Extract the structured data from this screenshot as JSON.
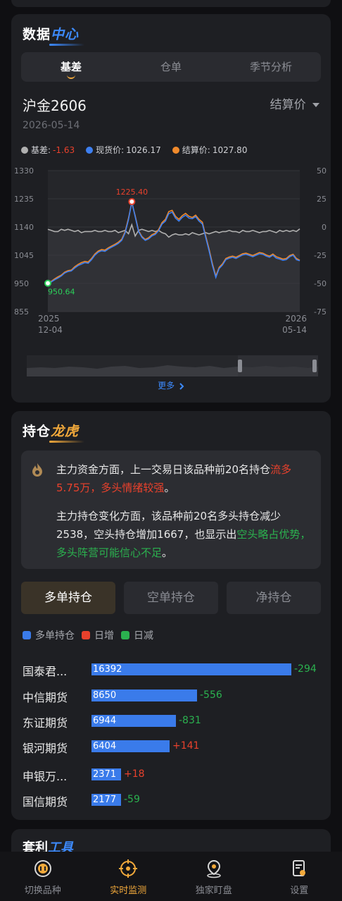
{
  "data_center": {
    "title_a": "数据",
    "title_b": "中心",
    "tabs": [
      "基差",
      "仓单",
      "季节分析"
    ],
    "active_tab": 0,
    "contract": "沪金2606",
    "price_type": "结算价",
    "date": "2026-05-14",
    "legend": {
      "basis_label": "基差:",
      "basis_value": "-1.63",
      "spot_label": "现货价:",
      "spot_value": "1026.17",
      "settle_label": "结算价:",
      "settle_value": "1027.80"
    },
    "more_label": "更多"
  },
  "chart_data": {
    "type": "line",
    "left_axis_ticks": [
      "1330",
      "1235",
      "1140",
      "1045",
      "950",
      "855"
    ],
    "right_axis_ticks": [
      "50",
      "25",
      "0",
      "-25",
      "-50",
      "-75"
    ],
    "ylim_left": [
      855,
      1330
    ],
    "ylim_right": [
      -75,
      50
    ],
    "x_start_label": [
      "2025",
      "12-04"
    ],
    "x_end_label": [
      "2026",
      "05-14"
    ],
    "max_label": "1225.40",
    "min_label": "950.64",
    "colors": {
      "basis": "#b0b0b0",
      "spot": "#3d7ff0",
      "settle": "#f08a2c",
      "max": "#e8412c",
      "min": "#2bd15a"
    },
    "series": [
      {
        "name": "现货价",
        "axis": "left",
        "values": [
          950.64,
          955,
          962,
          968,
          975,
          985,
          990,
          992,
          1002,
          1010,
          1015,
          1020,
          1018,
          1030,
          1045,
          1055,
          1060,
          1058,
          1066,
          1072,
          1078,
          1085,
          1095,
          1120,
          1165,
          1225.4,
          1175,
          1125,
          1105,
          1095,
          1100,
          1110,
          1115,
          1128,
          1150,
          1160,
          1185,
          1190,
          1170,
          1160,
          1172,
          1180,
          1170,
          1168,
          1175,
          1160,
          1150,
          1105,
          1060,
          1010,
          970,
          1000,
          1012,
          1030,
          1035,
          1038,
          1034,
          1040,
          1046,
          1048,
          1044,
          1040,
          1045,
          1050,
          1048,
          1042,
          1038,
          1045,
          1035,
          1032,
          1028,
          1030,
          1040,
          1045,
          1030,
          1026.17
        ]
      },
      {
        "name": "结算价",
        "axis": "left",
        "values": [
          952,
          957,
          965,
          972,
          978,
          988,
          993,
          995,
          1006,
          1014,
          1020,
          1024,
          1022,
          1034,
          1049,
          1059,
          1064,
          1062,
          1070,
          1076,
          1082,
          1089,
          1099,
          1124,
          1170,
          1222,
          1178,
          1128,
          1108,
          1098,
          1104,
          1114,
          1119,
          1132,
          1155,
          1166,
          1192,
          1196,
          1176,
          1166,
          1178,
          1186,
          1176,
          1172,
          1180,
          1166,
          1156,
          1110,
          1066,
          1016,
          975,
          1004,
          1016,
          1034,
          1039,
          1042,
          1038,
          1044,
          1050,
          1052,
          1048,
          1044,
          1049,
          1054,
          1052,
          1046,
          1042,
          1049,
          1040,
          1036,
          1032,
          1034,
          1044,
          1048,
          1034,
          1027.8
        ]
      },
      {
        "name": "基差",
        "axis": "right",
        "values": [
          -2,
          -3,
          -4,
          -4,
          -2,
          -3,
          -2,
          -3,
          -4,
          -3,
          -5,
          -4,
          -4,
          -4,
          -3,
          -4,
          -4,
          -3,
          -4,
          -4,
          -3,
          -5,
          -4,
          -3,
          -6,
          2,
          -8,
          -3,
          -2,
          -3,
          -4,
          -3,
          -4,
          -3,
          -5,
          -6,
          -9,
          -7,
          -6,
          -7,
          -7,
          -6,
          -7,
          -5,
          -6,
          -7,
          -6,
          -5,
          -6,
          -5,
          -4,
          -5,
          -4,
          -4,
          -3,
          -4,
          -4,
          -5,
          -3,
          -4,
          -4,
          -3,
          -4,
          -5,
          -4,
          -4,
          -3,
          -4,
          -5,
          -3,
          -4,
          -3,
          -4,
          -3,
          -4,
          -1.63
        ]
      }
    ]
  },
  "positions": {
    "title_a": "持仓",
    "title_b": "龙虎",
    "notice_p1_a": "主力资金方面，上一交易日该品种前20名持仓",
    "notice_p1_b": "流多5.75万，多头情绪较强",
    "notice_p1_c": "。",
    "notice_p2_a": "主力持仓变化方面，该品种前20名多头持仓减少2538，空头持仓增加1667，也显示出",
    "notice_p2_b": "空头略占优势，多头阵营可能信心不足",
    "notice_p2_c": "。",
    "tabs": [
      "多单持仓",
      "空单持仓",
      "净持仓"
    ],
    "active_tab": 0,
    "legend": [
      "多单持仓",
      "日增",
      "日减"
    ],
    "legend_colors": [
      "#3a7bea",
      "#e8412c",
      "#2bb14f"
    ],
    "max_value": 16392,
    "rows": [
      {
        "name": "国泰君...",
        "value": "16392",
        "amount": 16392,
        "delta": "-294",
        "dir": "down"
      },
      {
        "name": "中信期货",
        "value": "8650",
        "amount": 8650,
        "delta": "-556",
        "dir": "down"
      },
      {
        "name": "东证期货",
        "value": "6944",
        "amount": 6944,
        "delta": "-831",
        "dir": "down"
      },
      {
        "name": "银河期货",
        "value": "6404",
        "amount": 6404,
        "delta": "+141",
        "dir": "up"
      },
      {
        "name": "申银万...",
        "value": "2371",
        "amount": 2371,
        "delta": "+18",
        "dir": "up"
      },
      {
        "name": "国信期货",
        "value": "2177",
        "amount": 2177,
        "delta": "-59",
        "dir": "down"
      }
    ]
  },
  "arbitrage": {
    "title_a": "套利",
    "title_b": "工具"
  },
  "nav": {
    "items": [
      "切换品种",
      "实时监测",
      "独家盯盘",
      "设置"
    ],
    "active": 1
  }
}
